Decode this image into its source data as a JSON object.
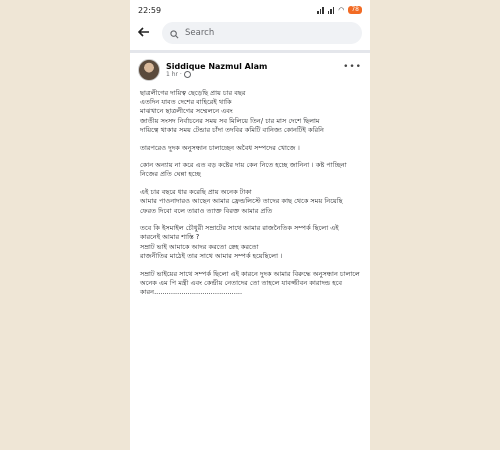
{
  "status": {
    "time": "22:59",
    "battery": "78"
  },
  "search": {
    "placeholder": "Search"
  },
  "post": {
    "author": "Siddique Nazmul Alam",
    "time": "1 hr ·",
    "paragraphs": [
      "ছাত্রলীগের দায়িত্ব ছেড়েছি প্রায় চার বছর\nএতদিন যাবত দেশের বাহিরেই থাকি\nমাঝখানে ছাত্রলীগের সম্মেলনে এবং\nজাতীয় সংসদ নির্বাচনের সময় সব মিলিয়ে তিন/ চার মাস দেশে ছিলাম\nদায়িত্বে থাকার সময় টেন্ডার চাঁদা তদবির কমিটি বানিজ্য কোনটিই করিনি",
      "তারপরেও দুদক অনুসন্ধান চালাচ্ছেন অবৈধ সম্পদের খোজে ।",
      "কোন অন্যায় না করে এত বড় কষ্টের দায় কেন নিতে হচ্ছে জানিনা । কষ্ট পাচ্ছিনা নিজের প্রতি ঘেন্না হচ্ছে",
      "এই চার বছরে ধার করেছি প্রায় অনেক টাকা\nআমার পাওনাদারও আছেন আমার ফ্রেন্ডলিস্টে তাদের কাছ থেকে সময় নিয়েছি ফেরত দিবো বলে তারাও ত্যাক্ত বিরক্ত আমার প্রতি",
      "তবে কি ইসমাইল চৌধুরী সম্রাটের সাথে আমার রাজনৈতিক সম্পর্ক ছিলো এই কারনেই আমার শাস্তি ?\nসম্রাট ভাই আমাকে আদর করতো স্নেহ করতো\nরাজনীতির মাঠেই তার সাথে আমার সম্পর্ক হয়েছিলো ।",
      "সম্রাট ভাইয়ের সাথে সম্পর্ক ছিলো এই কারনে দুদক আমার বিরুদ্ধে অনুসন্ধান চালালে অনেক এম পি মন্ত্রী এবং কেন্দ্রীয় নেতাদের তো তাহলে যাবজ্জীবন কারাদন্ড হবে\nকারন.........................................."
    ]
  }
}
